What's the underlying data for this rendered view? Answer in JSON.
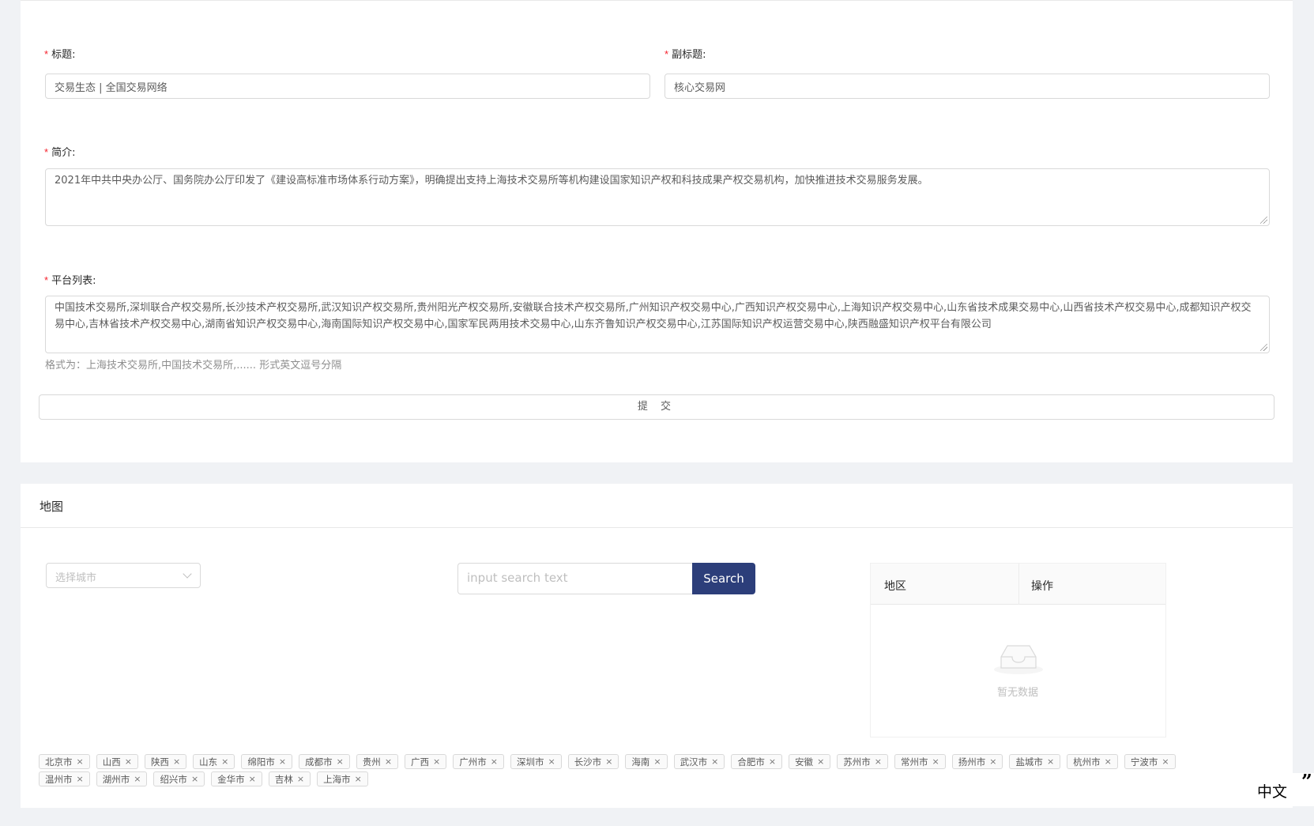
{
  "form": {
    "title_label": "标题:",
    "title_value": "交易生态 | 全国交易网络",
    "subtitle_label": "副标题:",
    "subtitle_value": "核心交易网",
    "intro_label": "简介:",
    "intro_value": "2021年中共中央办公厅、国务院办公厅印发了《建设高标准市场体系行动方案》，明确提出支持上海技术交易所等机构建设国家知识产权和科技成果产权交易机构，加快推进技术交易服务发展。",
    "platforms_label": "平台列表:",
    "platforms_value": "中国技术交易所,深圳联合产权交易所,长沙技术产权交易所,武汉知识产权交易所,贵州阳光产权交易所,安徽联合技术产权交易所,广州知识产权交易中心,广西知识产权交易中心,上海知识产权交易中心,山东省技术成果交易中心,山西省技术产权交易中心,成都知识产权交易中心,吉林省技术产权交易中心,湖南省知识产权交易中心,海南国际知识产权交易中心,国家军民两用技术交易中心,山东齐鲁知识产权交易中心,江苏国际知识产权运营交易中心,陕西融盛知识产权平台有限公司",
    "platforms_hint": "格式为：上海技术交易所,中国技术交易所,...... 形式英文逗号分隔",
    "required_mark": "*",
    "submit_label": "提 交"
  },
  "map": {
    "title": "地图",
    "city_select_placeholder": "选择城市",
    "search_placeholder": "input search text",
    "search_button": "Search",
    "table": {
      "col_region": "地区",
      "col_action": "操作",
      "empty_text": "暂无数据"
    },
    "tags": [
      "北京市",
      "山西",
      "陕西",
      "山东",
      "绵阳市",
      "成都市",
      "贵州",
      "广西",
      "广州市",
      "深圳市",
      "长沙市",
      "海南",
      "武汉市",
      "合肥市",
      "安徽",
      "苏州市",
      "常州市",
      "扬州市",
      "盐城市",
      "杭州市",
      "宁波市",
      "温州市",
      "湖州市",
      "绍兴市",
      "金华市",
      "吉林",
      "上海市"
    ],
    "tag_close_glyph": "×"
  },
  "language": {
    "label": "中文",
    "quote_glyph": "”"
  },
  "colors": {
    "primary_button": "#2c3e7a",
    "required": "#f5222d",
    "background": "#f0f2f5"
  },
  "icons": {
    "select_arrow": "chevron-down-icon",
    "empty": "inbox-icon",
    "tag_close": "close-icon"
  }
}
